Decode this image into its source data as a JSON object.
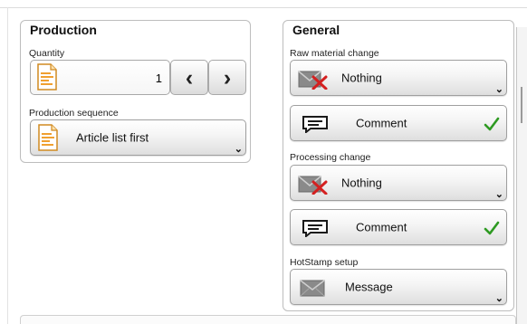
{
  "production": {
    "title": "Production",
    "quantity_label": "Quantity",
    "quantity_value": "1",
    "prev_glyph": "‹",
    "next_glyph": "›",
    "sequence_label": "Production sequence",
    "sequence_value": "Article list first"
  },
  "general": {
    "title": "General",
    "raw_material": {
      "label": "Raw material change",
      "option": "Nothing",
      "comment": "Comment"
    },
    "processing": {
      "label": "Processing change",
      "option": "Nothing",
      "comment": "Comment"
    },
    "hotstamp": {
      "label": "HotStamp setup",
      "option": "Message"
    }
  },
  "icons": {
    "document": "document-icon",
    "envelope_x": "envelope-x-icon",
    "comment": "comment-bubble-icon",
    "checkmark": "checkmark-icon",
    "envelope": "envelope-icon"
  },
  "colors": {
    "doc_accent": "#f0a030",
    "x_red": "#d42020",
    "check_green": "#2e9a22"
  }
}
